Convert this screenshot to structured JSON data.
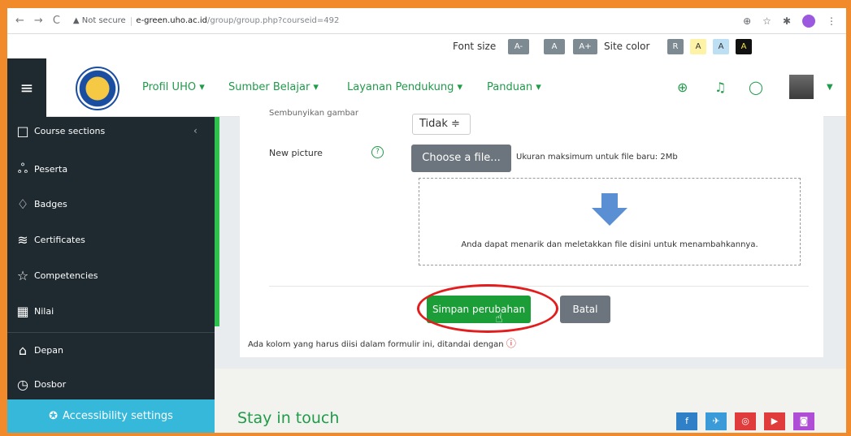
{
  "browser": {
    "back": "←",
    "forward": "→",
    "reload": "C",
    "security": "▲ Not secure",
    "domain": "e-green.uho.ac.id",
    "path": "/group/group.php?courseid=492"
  },
  "topbar": {
    "font_size_label": "Font size",
    "font_buttons": [
      "A-",
      "A",
      "A+"
    ],
    "site_color_label": "Site color",
    "color_buttons": [
      "R",
      "A",
      "A",
      "A"
    ]
  },
  "navbar": {
    "menu_icon": "≡",
    "items": [
      "Profil UHO ▾",
      "Sumber Belajar ▾",
      "Layanan Pendukung ▾",
      "Panduan ▾"
    ],
    "icons": [
      "globe-icon",
      "bell-icon",
      "chat-icon"
    ]
  },
  "sidebar": {
    "items": [
      {
        "label": "Course sections",
        "icon": "□"
      },
      {
        "label": "Peserta",
        "icon": "ஃ"
      },
      {
        "label": "Badges",
        "icon": "♢"
      },
      {
        "label": "Certificates",
        "icon": "≋"
      },
      {
        "label": "Competencies",
        "icon": "☆"
      },
      {
        "label": "Nilai",
        "icon": "▦"
      },
      {
        "label": "Depan",
        "icon": "⌂"
      },
      {
        "label": "Dosbor",
        "icon": "◷"
      }
    ],
    "collapse": "‹",
    "accessibility": "Accessibility settings"
  },
  "form": {
    "hidden_label": "Sembunyikan gambar",
    "select_value": "Tidak ≑",
    "new_picture_label": "New picture",
    "help": "?",
    "choose_file": "Choose a file...",
    "max_size": "Ukuran maksimum untuk file baru: 2Mb",
    "drop_text": "Anda dapat menarik dan meletakkan file disini untuk menambahkannya.",
    "save": "Simpan perubahan",
    "cancel": "Batal",
    "required_note": "Ada kolom yang harus diisi dalam formulir ini, ditandai dengan",
    "required_icon": "!"
  },
  "footer": {
    "stay_in_touch": "Stay in touch",
    "social": [
      {
        "icon": "f",
        "color": "#2f80c7"
      },
      {
        "icon": "🕊",
        "color": "#3a9bd8"
      },
      {
        "icon": "◎",
        "color": "#e03c3c"
      },
      {
        "icon": "▶",
        "color": "#e03c3c"
      },
      {
        "icon": "◎",
        "color": "#b04dd6"
      }
    ]
  },
  "colors": {
    "accent": "#1f9b4a",
    "sidebar_bg": "#1f2a30",
    "save_bg": "#1b9d37",
    "highlight_circle": "#e31d1d",
    "frame": "#f08a2b"
  }
}
